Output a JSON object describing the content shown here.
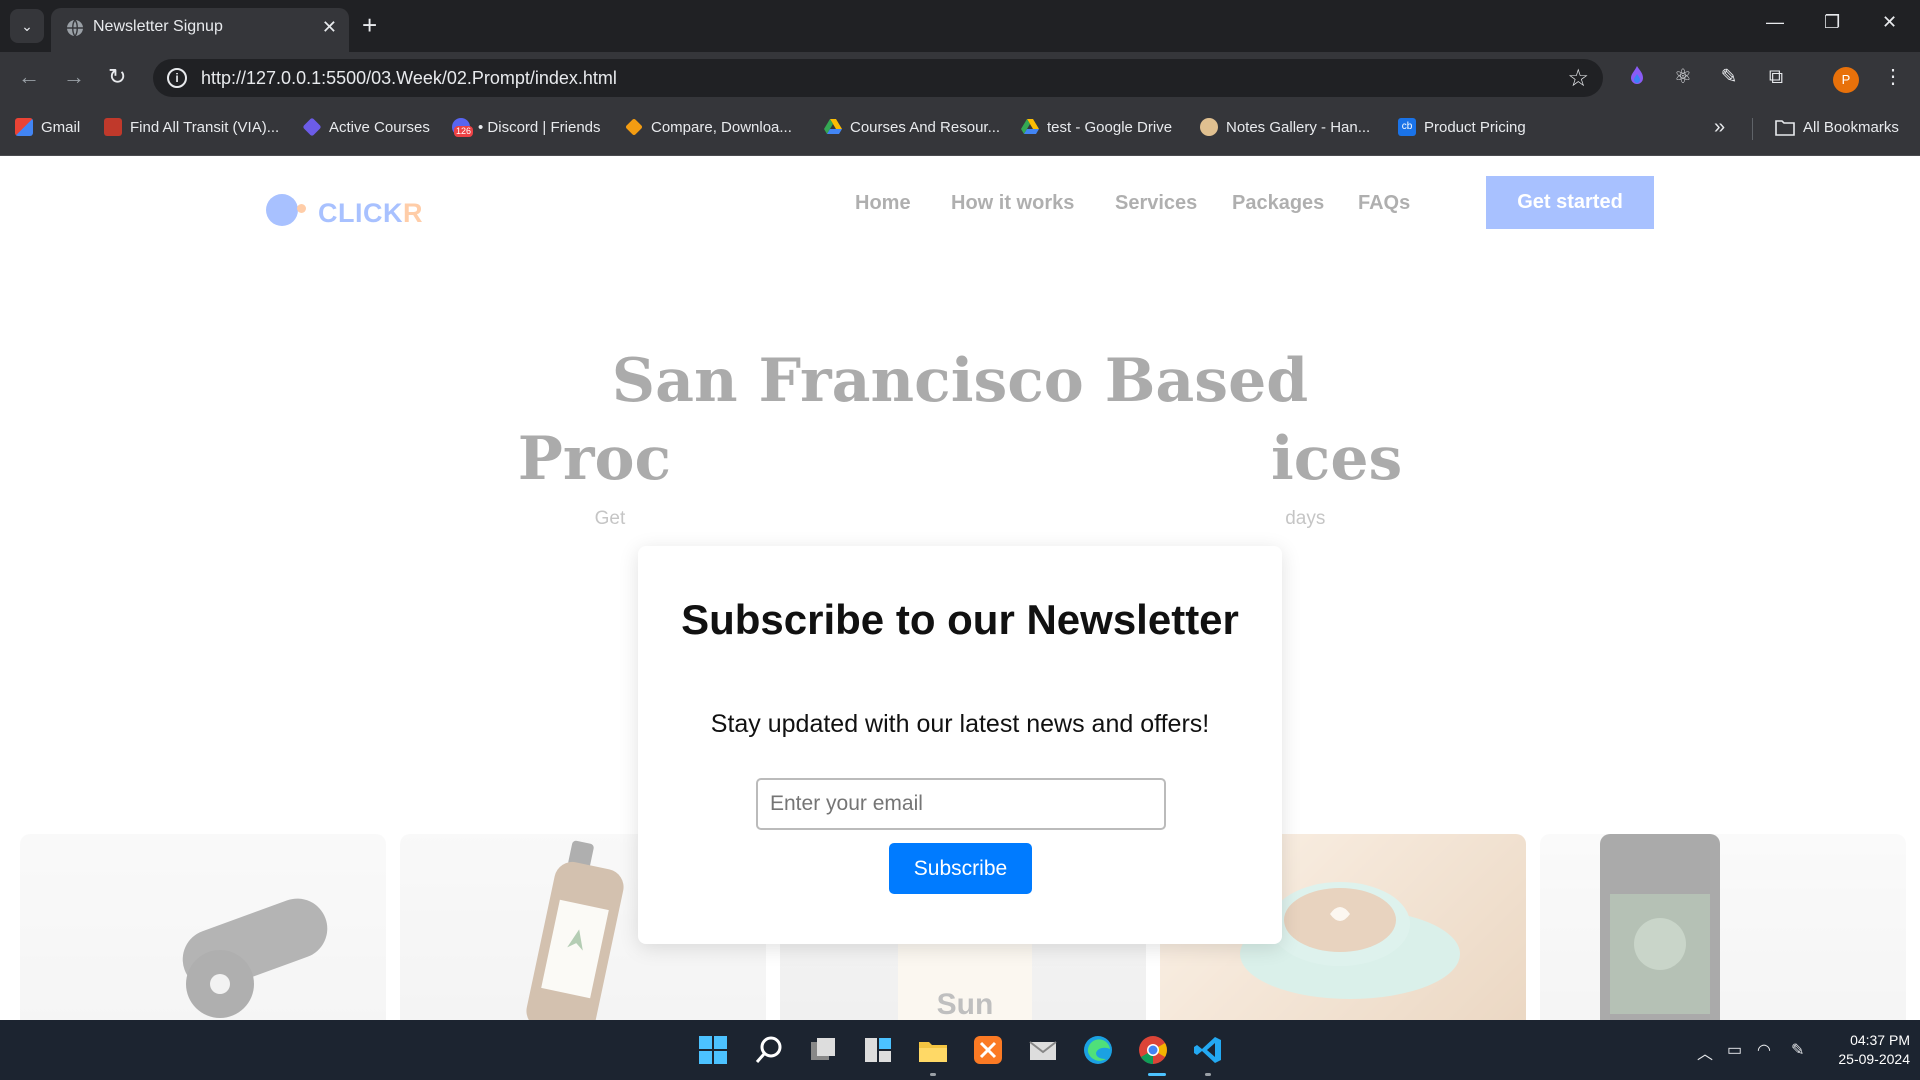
{
  "browser": {
    "tab_title": "Newsletter Signup",
    "url": "http://127.0.0.1:5500/03.Week/02.Prompt/index.html",
    "bookmarks": [
      {
        "label": "Gmail",
        "icon": "gmail-icon",
        "color": "#ea4335"
      },
      {
        "label": "Find All Transit (VIA)...",
        "icon": "transit-icon",
        "color": "#c0392b"
      },
      {
        "label": "Active Courses",
        "icon": "courses-icon",
        "color": "#6c5ce7"
      },
      {
        "label": "• Discord | Friends",
        "icon": "discord-icon",
        "color": "#5865f2"
      },
      {
        "label": "Compare, Downloa...",
        "icon": "compare-icon",
        "color": "#f39c12"
      },
      {
        "label": "Courses And Resour...",
        "icon": "drive-icon",
        "color": "#34a853"
      },
      {
        "label": "test - Google Drive",
        "icon": "drive-icon",
        "color": "#fbbc04"
      },
      {
        "label": "Notes Gallery - Han...",
        "icon": "notes-icon",
        "color": "#e0c090"
      },
      {
        "label": "Product Pricing",
        "icon": "cb-icon",
        "color": "#1a73e8"
      }
    ],
    "discord_badge": "126",
    "all_bookmarks": "All Bookmarks",
    "profile_initial": "P"
  },
  "site": {
    "logo_text": "CLICK",
    "logo_text_accent": "R",
    "nav": [
      "Home",
      "How it works",
      "Services",
      "Packages",
      "FAQs"
    ],
    "cta": "Get started",
    "hero_line1": "San Francisco Based",
    "hero_line2_left": "Proc",
    "hero_line2_right": "ices",
    "hero_sub_left": "Get",
    "hero_sub_right": "days",
    "brand_color": "#1a5cff",
    "accent_color": "#ff7a1a"
  },
  "modal": {
    "title": "Subscribe to our Newsletter",
    "description": "Stay updated with our latest news and offers!",
    "email_placeholder": "Enter your email",
    "button": "Subscribe",
    "button_color": "#007bff"
  },
  "taskbar": {
    "time": "04:37 PM",
    "date": "25-09-2024"
  }
}
